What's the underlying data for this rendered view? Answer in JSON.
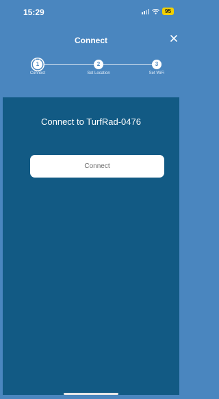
{
  "status_bar": {
    "time": "15:29",
    "battery": "95",
    "icons": [
      "signal-icon",
      "wifi-icon",
      "battery-icon"
    ]
  },
  "header": {
    "title": "Connect",
    "close_icon": "close-icon"
  },
  "stepper": {
    "current_step": 1,
    "steps": [
      {
        "number": "1",
        "label": "Connect"
      },
      {
        "number": "2",
        "label": "Set Location"
      },
      {
        "number": "3",
        "label": "Set WiFi"
      }
    ],
    "active_indicator_icon": "chevron-down-icon"
  },
  "main": {
    "title": "Connect to TurfRad-0476",
    "connect_button_label": "Connect"
  },
  "colors": {
    "header_background": "#4a86bf",
    "panel_background": "#125a84",
    "button_background": "#ffffff",
    "battery": "#f2d000"
  }
}
